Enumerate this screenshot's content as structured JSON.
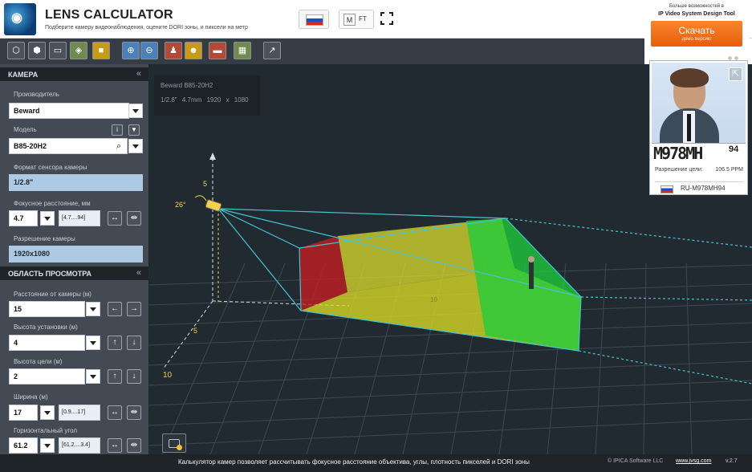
{
  "app": {
    "title": "LENS CALCULATOR",
    "subtitle": "Подберите камеру видеонаблюдения, оцените DORI зоны, и пиксели на метр"
  },
  "header": {
    "units": {
      "meters": "M",
      "feet": "FT"
    }
  },
  "promo": {
    "line1": "Больше возможностей в",
    "line2": "IP Video System Design Tool",
    "download_label": "Скачать",
    "download_sub": "демо версию"
  },
  "camera_info": {
    "model": "Beward B85-20H2",
    "sensor": "1/2.8\"",
    "focal": "4.7mm",
    "resolution": "1920 x 1080"
  },
  "camera": {
    "title": "КАМЕРА",
    "manufacturer_label": "Производитель",
    "manufacturer": "Beward",
    "model_label": "Модель",
    "model": "B85-20H2",
    "sensor_label": "Формат сенсора камеры",
    "sensor": "1/2.8\"",
    "focal_label": "Фокусное расстояние, мм",
    "focal": "4.7",
    "focal_range": "[4.7....94]",
    "resolution_label": "Разрешение камеры",
    "resolution": "1920x1080"
  },
  "view": {
    "title": "ОБЛАСТЬ ПРОСМОТРА",
    "distance_label": "Расстояние от камеры (м)",
    "distance": "15",
    "height_label": "Высота установки (м)",
    "height": "4",
    "target_height_label": "Высота цели (м)",
    "target_height": "2",
    "width_label": "Ширина (м)",
    "width": "17",
    "width_range": "[0.9....17]",
    "angle_label": "Горизонтальный угол",
    "angle": "61.2",
    "angle_range": "[61.2....3.4]"
  },
  "scene": {
    "axis_labels": [
      "5",
      "5",
      "10",
      "10"
    ],
    "angle_text": "26°"
  },
  "preview": {
    "plate": "М978МН",
    "plate_small": "94",
    "resolution_label": "Разрешение цели:",
    "resolution_value": "106.5 PPM",
    "plate_code": "RU-M978MH94"
  },
  "footer": {
    "description": "Калькулятор камер позволяет рассчитывать фокусное расстояние объектива, углы, плотность пикселей и DORI зоны",
    "company": "© IPICA Software LLC",
    "link": "www.jvsg.com",
    "version": "v.2.7"
  },
  "colors": {
    "red_zone": "#c51d24",
    "yellow_zone": "#e2e42b",
    "green_zone": "#1fcc3d",
    "wire": "#46c4d1"
  }
}
